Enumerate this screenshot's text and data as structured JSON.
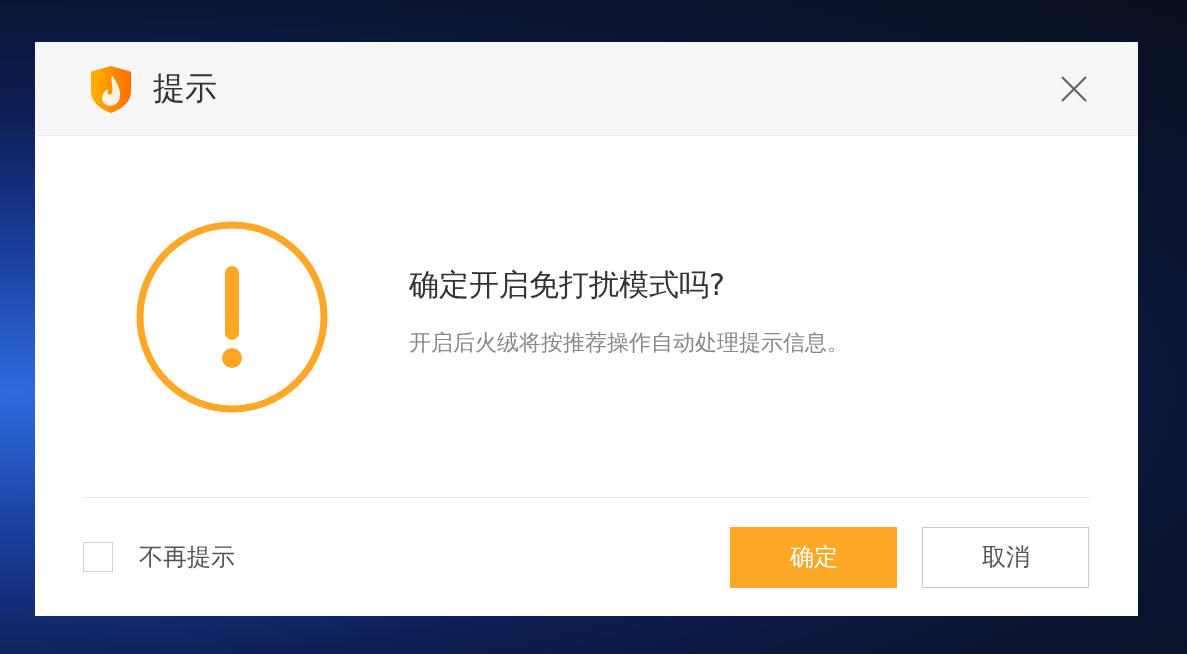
{
  "dialog": {
    "title": "提示",
    "message": {
      "heading": "确定开启免打扰模式吗?",
      "detail": "开启后火绒将按推荐操作自动处理提示信息。"
    },
    "dont_show_again": {
      "label": "不再提示",
      "checked": false
    },
    "buttons": [
      {
        "label": "确定",
        "kind": "primary"
      },
      {
        "label": "取消",
        "kind": "secondary"
      }
    ]
  }
}
